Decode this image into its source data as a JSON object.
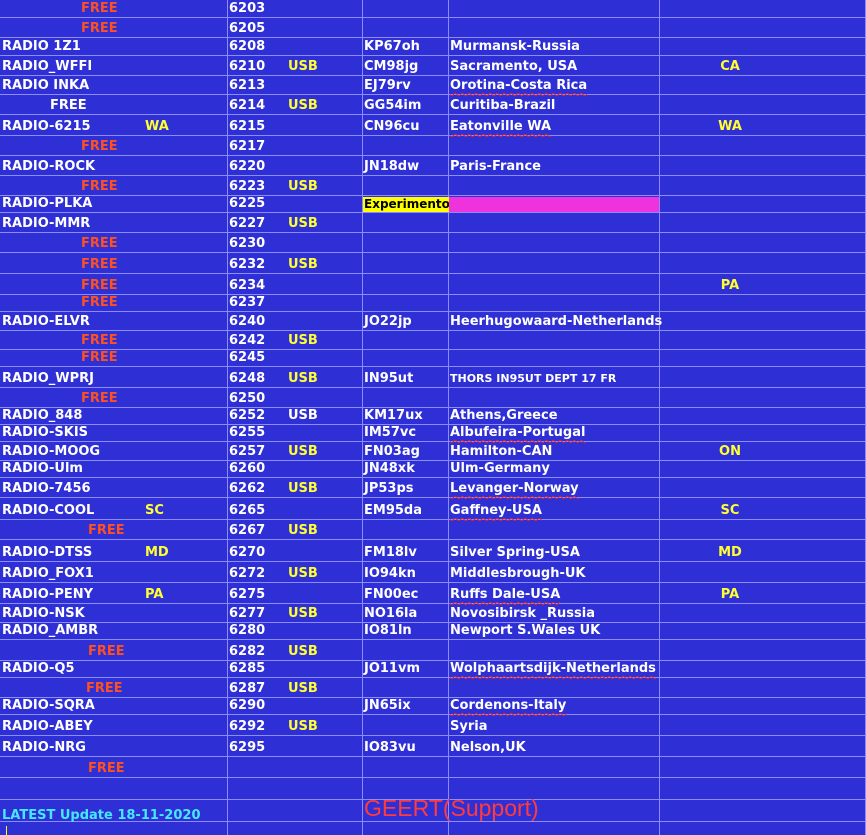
{
  "rows": [
    {
      "name": "FREE",
      "free": true,
      "freq": "6203"
    },
    {
      "name": "FREE",
      "free": true,
      "freq": "6205"
    },
    {
      "name": "RADIO 1Z1",
      "freq": "6208",
      "loc": "KP67oh",
      "city": "Murmansk-Russia"
    },
    {
      "name": "RADIO_WFFI",
      "freq": "6210",
      "mode": "USB",
      "loc": "CM98jg",
      "city": "Sacramento, USA",
      "state": "CA"
    },
    {
      "name": "RADIO INKA",
      "freq": "6213",
      "loc": "EJ79rv",
      "city": "Orotina-Costa Rica"
    },
    {
      "name": "FREE",
      "whiteFree": true,
      "freq": "6214",
      "mode": "USB",
      "loc": "GG54im",
      "city": "Curitiba-Brazil"
    },
    {
      "name": "RADIO-6215",
      "tag1": "WA",
      "freq": "6215",
      "loc": "CN96cu",
      "city": "Eatonville WA",
      "state": "WA"
    },
    {
      "name": "FREE",
      "free": true,
      "freq": "6217"
    },
    {
      "name": "RADIO-ROCK",
      "freq": "6220",
      "loc": "JN18dw",
      "city": "Paris-France"
    },
    {
      "name": "FREE",
      "free": true,
      "freq": "6223",
      "mode": "USB"
    },
    {
      "name": "RADIO-PLKA",
      "freq": "6225",
      "experiment": "Experimento"
    },
    {
      "name": "RADIO-MMR",
      "freq": "6227",
      "mode": "USB"
    },
    {
      "name": "FREE",
      "free": true,
      "freq": "6230"
    },
    {
      "name": "FREE",
      "free": true,
      "freq": "6232",
      "mode": "USB"
    },
    {
      "name": "FREE",
      "free": true,
      "freq": "6234",
      "state": "PA"
    },
    {
      "name": "FREE",
      "free": true,
      "freq": "6237"
    },
    {
      "name": "RADIO-ELVR",
      "freq": "6240",
      "loc": "JO22jp",
      "city": "Heerhugowaard-Netherlands"
    },
    {
      "name": "FREE",
      "free": true,
      "freq": "6242",
      "mode": "USB"
    },
    {
      "name": "FREE",
      "free": true,
      "freq": "6245"
    },
    {
      "name": "RADIO_WPRJ",
      "freq": "6248",
      "mode": "USB",
      "loc": "IN95ut",
      "city": "THORS IN95UT DEPT 17 FR"
    },
    {
      "name": "FREE",
      "free": true,
      "freq": "6250"
    },
    {
      "name": "RADIO_848",
      "freq": "6252",
      "mode": "USB",
      "loc": "KM17ux",
      "city": "Athens,Greece"
    },
    {
      "name": "RADIO-SKIS",
      "freq": "6255",
      "loc": "IM57vc",
      "city": "Albufeira-Portugal"
    },
    {
      "name": "RADIO-MOOG",
      "freq": "6257",
      "mode": "USB",
      "loc": "FN03ag",
      "city": "Hamilton-CAN",
      "state": "ON"
    },
    {
      "name": "RADIO-Ulm",
      "freq": "6260",
      "loc": "JN48xk",
      "city": "Ulm-Germany"
    },
    {
      "name": "RADIO-7456",
      "freq": "6262",
      "mode": "USB",
      "loc": "JP53ps",
      "city": "Levanger-Norway"
    },
    {
      "name": "RADIO-COOL",
      "tag1": "SC",
      "freq": "6265",
      "loc": "EM95da",
      "city": "Gaffney-USA",
      "state": "SC"
    },
    {
      "name": "FREE",
      "free": true,
      "freq": "6267",
      "mode": "USB"
    },
    {
      "name": "RADIO-DTSS",
      "tag1": "MD",
      "freq": "6270",
      "loc": "FM18lv",
      "city": "Silver Spring-USA",
      "state": "MD"
    },
    {
      "name": "RADIO_FOX1",
      "freq": "6272",
      "mode": "USB",
      "loc": "IO94kn",
      "city": "Middlesbrough-UK"
    },
    {
      "name": "RADIO-PENY",
      "tag1": "PA",
      "freq": "6275",
      "loc": "FN00ec",
      "city": "Ruffs Dale-USA",
      "state": "PA"
    },
    {
      "name": "RADIO-NSK",
      "freq": "6277",
      "mode": "USB",
      "loc": "NO16la",
      "city": "Novosibirsk _Russia"
    },
    {
      "name": "RADIO_AMBR",
      "freq": "6280",
      "loc": "IO81ln",
      "city": "Newport S.Wales  UK"
    },
    {
      "name": "FREE",
      "free": true,
      "freq": "6282",
      "mode": "USB"
    },
    {
      "name": "RADIO-Q5",
      "freq": "6285",
      "loc": "JO11vm",
      "city": "Wolphaartsdijk-Netherlands"
    },
    {
      "name": "FREE",
      "free": true,
      "freq": "6287",
      "mode": "USB"
    },
    {
      "name": "RADIO-SQRA",
      "freq": "6290",
      "loc": "JN65ix",
      "city": "Cordenons-Italy"
    },
    {
      "name": "RADIO-ABEY",
      "freq": "6292",
      "mode": "USB",
      "city": "Syria"
    },
    {
      "name": "RADIO-NRG",
      "freq": "6295",
      "loc": "IO83vu",
      "city": "Nelson,UK"
    },
    {
      "name": "FREE",
      "free": true
    },
    {},
    {}
  ],
  "footer": {
    "update": "LATEST Update 18-11-2020",
    "support": "GEERT(Support)"
  }
}
